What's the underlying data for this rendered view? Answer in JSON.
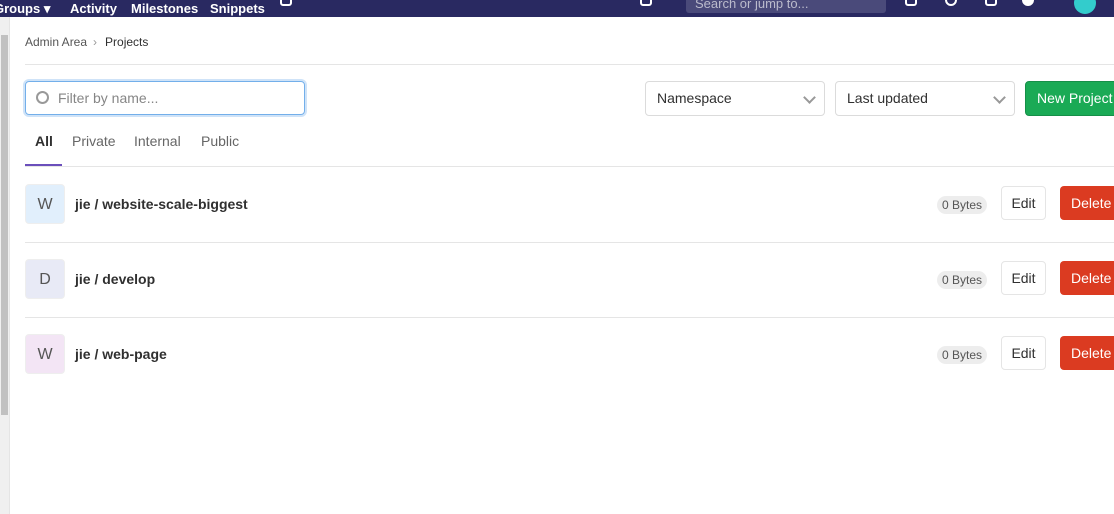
{
  "nav": {
    "groups": "Groups ▾",
    "activity": "Activity",
    "milestones": "Milestones",
    "snippets": "Snippets",
    "search_placeholder": "Search or jump to..."
  },
  "breadcrumb": {
    "parent": "Admin Area",
    "separator": "›",
    "current": "Projects"
  },
  "filter": {
    "placeholder": "Filter by name..."
  },
  "namespace_select": "Namespace",
  "sort_select": "Last updated",
  "new_project": "New Project",
  "tabs": [
    {
      "label": "All"
    },
    {
      "label": "Private"
    },
    {
      "label": "Internal"
    },
    {
      "label": "Public"
    }
  ],
  "projects": [
    {
      "initial": "W",
      "name": "jie / website-scale-biggest",
      "size": "0 Bytes",
      "color": "#e1effc"
    },
    {
      "initial": "D",
      "name": "jie / develop",
      "size": "0 Bytes",
      "color": "#e8eaf6"
    },
    {
      "initial": "W",
      "name": "jie / web-page",
      "size": "0 Bytes",
      "color": "#f3e5f5"
    }
  ],
  "actions": {
    "edit": "Edit",
    "delete": "Delete"
  }
}
